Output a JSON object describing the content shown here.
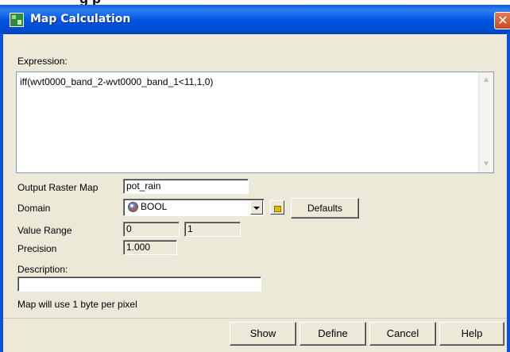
{
  "window": {
    "title": "Map Calculation",
    "partial_top_text": "g                 p"
  },
  "expression": {
    "label": "Expression:",
    "value": "iff(wvt0000_band_2-wvt0000_band_1<11,1,0)"
  },
  "output_raster_map": {
    "label": "Output Raster Map",
    "value": "pot_rain"
  },
  "domain": {
    "label": "Domain",
    "value": "BOOL",
    "defaults_label": "Defaults"
  },
  "value_range": {
    "label": "Value Range",
    "min": "0",
    "max": "1"
  },
  "precision": {
    "label": "Precision",
    "value": "1.000"
  },
  "description": {
    "label": "Description:",
    "value": ""
  },
  "info_text": "Map will use 1 byte per pixel",
  "buttons": {
    "show": "Show",
    "define": "Define",
    "cancel": "Cancel",
    "help": "Help"
  }
}
